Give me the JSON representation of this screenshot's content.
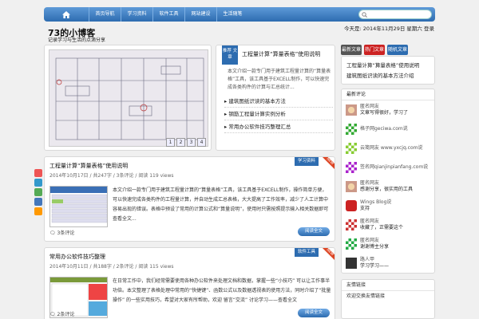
{
  "nav": {
    "items": [
      "首页导航",
      "学习资料",
      "软件工具",
      "网站建设",
      "生活随笔"
    ],
    "search_placeholder": ""
  },
  "header": {
    "title": "73的小博客",
    "subtitle": "记录学习与生活的点滴分享",
    "date_line": "今天是: 2014年11月29日 星期六   登录"
  },
  "slider": {
    "pages": [
      "1",
      "2",
      "3",
      "4"
    ]
  },
  "featured": {
    "tag": "推荐 文章",
    "title": "工程量计算“算量表格”使用说明",
    "desc": "本文介绍一款专门用于建筑工程量计算的“算量表格”工具，该工具基于EXCELL制作，可以快速完成各类构件的计算与汇总统计...",
    "links": [
      "建筑图纸识读的基本方法",
      "钢筋工程量计算实例分析",
      "常用办公软件技巧整理汇总"
    ]
  },
  "sidebar": {
    "tabs": [
      "最新文章",
      "热门文章",
      "随机文章"
    ],
    "tab_colors": [
      "#555555",
      "#cc2222",
      "#2d6cb0"
    ],
    "box1_lines": [
      "工程量计算“算量表格”使用说明",
      "建筑图纸识读的基本方法介绍"
    ],
    "friends_head": "最新评论",
    "friends": [
      {
        "name": "匿名网友",
        "text": "文章写得很好，学习了"
      },
      {
        "name": "格子网geciwa.com说",
        "text": ""
      },
      {
        "name": "云笺网友 www.yxcjq.com说",
        "text": ""
      },
      {
        "name": "签名网qianjinpianfang.com说",
        "text": ""
      },
      {
        "name": "匿名网友",
        "text": "感谢分享，很实用的工具"
      },
      {
        "name": "Wings Blog说",
        "text": "支持"
      },
      {
        "name": "匿名网友",
        "text": "收藏了，正需要这个"
      },
      {
        "name": "匿名网友",
        "text": "谢谢博主分享"
      },
      {
        "name": "路人甲",
        "text": "学习学习——"
      }
    ],
    "box3_head": "友情链接",
    "box3_line": "欢迎交换友情链接"
  },
  "posts": [
    {
      "title": "工程量计算“算量表格”使用说明",
      "meta": "2014年10月17日 / 共247字 / 3条评论 / 阅读 119 views",
      "cat": "学习资料",
      "new": "NEW",
      "body": "本文介绍一款专门用于建筑工程量计算的“算量表格”工具，该工具基于EXCELL制作，操作简单方便，可以快速完成各类构件的工程量计算，并自动生成汇总表格，大大提高了工作效率，减少了人工计算中容易出现的错误。表格中预设了常用的计算公式和“算量说明”，使用时只需按照提示输入相关数据即可 查看全文...",
      "comments": "3条评论",
      "readmore": "阅读全文"
    },
    {
      "title": "常用办公软件技巧整理",
      "meta": "2014年10月11日 / 共188字 / 2条评论 / 阅读 115 views",
      "cat": "软件工具",
      "new": "NEW",
      "body": "在日常工作中，我们经常需要使用各种办公软件来处理文档和数据，掌握一些“小技巧” 可以让工作事半功倍。本文整理了表格处理中常用的“快捷键”、函数公式以及数据透视表的使用方法，同时介绍了“批量操作” 的一些实用技巧，希望对大家有所帮助，欢迎 留言“交流” 讨论学习——查看全文",
      "comments": "2条评论",
      "readmore": "阅读全文"
    }
  ]
}
